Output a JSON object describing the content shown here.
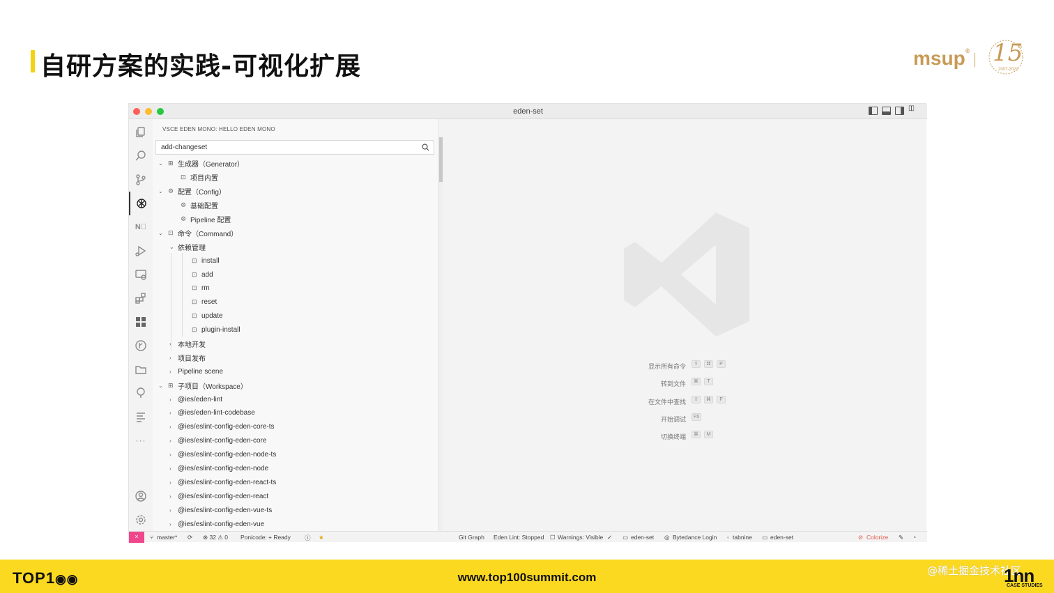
{
  "slide": {
    "title": "自研方案的实践-可视化扩展",
    "logo_text": "msup",
    "logo_reg": "®",
    "anniversary": "15",
    "anniversary_sup": "th",
    "anniversary_years": "2007-2022"
  },
  "window": {
    "title": "eden-set"
  },
  "sidebar": {
    "header": "VSCE EDEN MONO: HELLO EDEN MONO",
    "search_value": "add-changeset",
    "tree": [
      {
        "depth": 0,
        "chevron": "⌄",
        "icon": "⊞",
        "label": "生成器（Generator）"
      },
      {
        "depth": 1,
        "chevron": "",
        "icon": "⊡",
        "label": "项目内置"
      },
      {
        "depth": 0,
        "chevron": "⌄",
        "icon": "⚙",
        "label": "配置（Config）"
      },
      {
        "depth": 1,
        "chevron": "",
        "icon": "⚙",
        "label": "基础配置"
      },
      {
        "depth": 1,
        "chevron": "",
        "icon": "⚙",
        "label": "Pipeline 配置"
      },
      {
        "depth": 0,
        "chevron": "⌄",
        "icon": "⊡",
        "label": "命令（Command）"
      },
      {
        "depth": 1,
        "chevron": "⌄",
        "icon": "",
        "label": "依赖管理"
      },
      {
        "depth": 2,
        "chevron": "",
        "icon": "⊡",
        "label": "install"
      },
      {
        "depth": 2,
        "chevron": "",
        "icon": "⊡",
        "label": "add"
      },
      {
        "depth": 2,
        "chevron": "",
        "icon": "⊡",
        "label": "rm"
      },
      {
        "depth": 2,
        "chevron": "",
        "icon": "⊡",
        "label": "reset"
      },
      {
        "depth": 2,
        "chevron": "",
        "icon": "⊡",
        "label": "update"
      },
      {
        "depth": 2,
        "chevron": "",
        "icon": "⊡",
        "label": "plugin-install"
      },
      {
        "depth": 1,
        "chevron": "›",
        "icon": "",
        "label": "本地开发"
      },
      {
        "depth": 1,
        "chevron": "›",
        "icon": "",
        "label": "项目发布"
      },
      {
        "depth": 1,
        "chevron": "›",
        "icon": "",
        "label": "Pipeline scene"
      },
      {
        "depth": 0,
        "chevron": "⌄",
        "icon": "⊞",
        "label": "子项目（Workspace）"
      },
      {
        "depth": 1,
        "chevron": "›",
        "icon": "",
        "label": "@ies/eden-lint"
      },
      {
        "depth": 1,
        "chevron": "›",
        "icon": "",
        "label": "@ies/eden-lint-codebase"
      },
      {
        "depth": 1,
        "chevron": "›",
        "icon": "",
        "label": "@ies/eslint-config-eden-core-ts"
      },
      {
        "depth": 1,
        "chevron": "›",
        "icon": "",
        "label": "@ies/eslint-config-eden-core"
      },
      {
        "depth": 1,
        "chevron": "›",
        "icon": "",
        "label": "@ies/eslint-config-eden-node-ts"
      },
      {
        "depth": 1,
        "chevron": "›",
        "icon": "",
        "label": "@ies/eslint-config-eden-node"
      },
      {
        "depth": 1,
        "chevron": "›",
        "icon": "",
        "label": "@ies/eslint-config-eden-react-ts"
      },
      {
        "depth": 1,
        "chevron": "›",
        "icon": "",
        "label": "@ies/eslint-config-eden-react"
      },
      {
        "depth": 1,
        "chevron": "›",
        "icon": "",
        "label": "@ies/eslint-config-eden-vue-ts"
      },
      {
        "depth": 1,
        "chevron": "›",
        "icon": "",
        "label": "@ies/eslint-config-eden-vue"
      }
    ]
  },
  "editor": {
    "commands": [
      {
        "label": "显示所有命令",
        "keys": [
          "⇧",
          "⌘",
          "P"
        ]
      },
      {
        "label": "转到文件",
        "keys": [
          "⌘",
          "T"
        ]
      },
      {
        "label": "在文件中查找",
        "keys": [
          "⇧",
          "⌘",
          "F"
        ]
      },
      {
        "label": "开始调试",
        "keys": [
          "F5"
        ]
      },
      {
        "label": "切换终端",
        "keys": [
          "⌘",
          "M"
        ]
      }
    ]
  },
  "statusbar": {
    "remote": "×",
    "branch": "master*",
    "sync": "⟳",
    "problems": "⊗ 32 ⚠ 0",
    "ponicode": "Ponicode: ⌖ Ready",
    "info": "ⓘ",
    "star": "★",
    "git_graph": "Git Graph",
    "eden_lint": "Eden Lint: Stopped",
    "warnings": "Warnings: Visible",
    "folder1": "eden-set",
    "bytedance": "Bytedance Login",
    "tabnine": "tabnine",
    "folder2": "eden-set",
    "colorize": "Colorize"
  },
  "footer": {
    "brand": "TOP1",
    "site": "www.top100summit.com",
    "watermark": "@稀土掘金技术社区",
    "case": "1nn",
    "case_sub": "CASE STUDIES"
  }
}
